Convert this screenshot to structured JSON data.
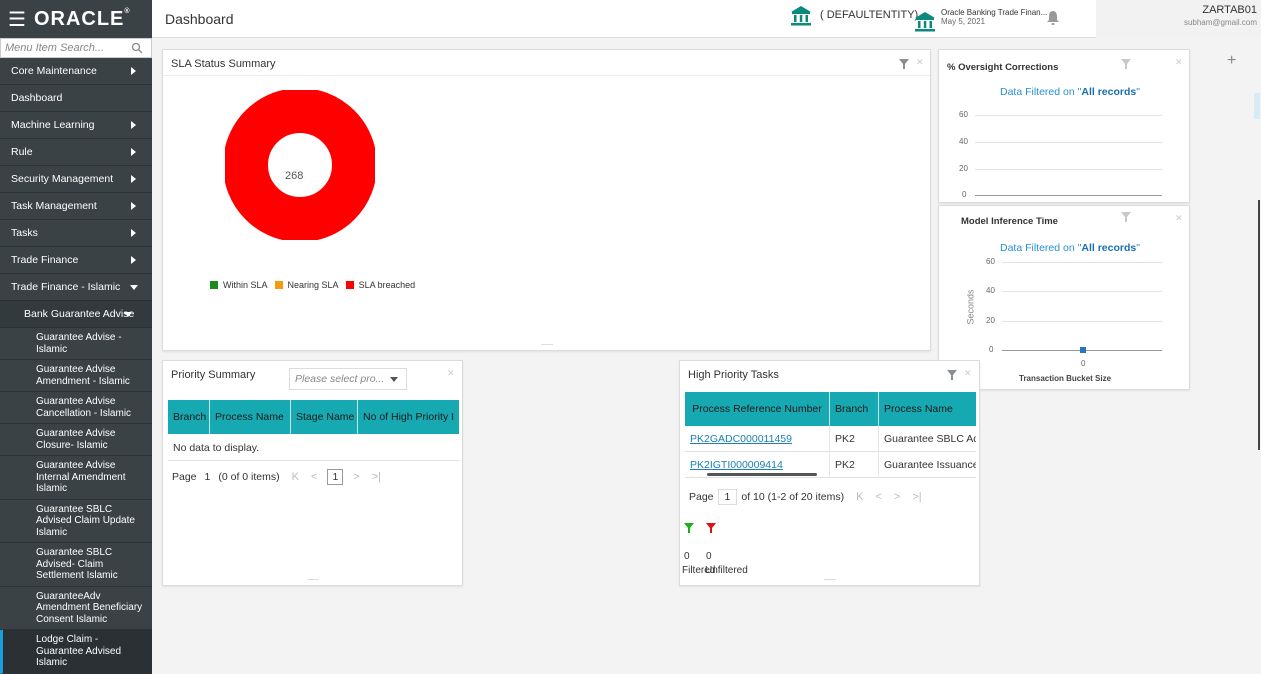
{
  "header": {
    "logo": "ORACLE",
    "page_title": "Dashboard",
    "entity": "( DEFAULTENTITY)",
    "app_name": "Oracle Banking Trade Finan...",
    "app_date": "May 5, 2021",
    "user_name": "ZARTAB01",
    "user_email": "subham@gmail.com"
  },
  "sidebar": {
    "search_placeholder": "Menu Item Search...",
    "items": [
      {
        "label": "Core Maintenance"
      },
      {
        "label": "Dashboard"
      },
      {
        "label": "Machine Learning"
      },
      {
        "label": "Rule"
      },
      {
        "label": "Security Management"
      },
      {
        "label": "Task Management"
      },
      {
        "label": "Tasks"
      },
      {
        "label": "Trade Finance"
      },
      {
        "label": "Trade Finance - Islamic"
      }
    ],
    "sub_group": "Bank Guarantee Advise",
    "leaves": [
      "Guarantee Advise - Islamic",
      "Guarantee Advise Amendment - Islamic",
      "Guarantee Advise Cancellation - Islamic",
      "Guarantee Advise Closure- Islamic",
      "Guarantee Advise Internal Amendment Islamic",
      "Guarantee SBLC Advised Claim Update Islamic",
      "Guarantee SBLC Advised- Claim Settlement Islamic",
      "GuaranteeAdv Amendment Beneficiary Consent Islamic",
      "Lodge Claim - Guarantee Advised Islamic"
    ]
  },
  "sla": {
    "title": "SLA Status Summary",
    "center_value": "268",
    "legend": [
      "Within SLA",
      "Nearing SLA",
      "SLA breached"
    ],
    "colors": {
      "within": "#1a8a1a",
      "nearing": "#f39c12",
      "breached": "#ff0000"
    }
  },
  "oversight": {
    "title": "% Oversight Corrections",
    "filter_prefix": "Data Filtered on \"",
    "filter_value": "All records",
    "filter_suffix": "\"",
    "y_ticks": [
      "60",
      "40",
      "20",
      "0"
    ]
  },
  "model": {
    "title": "Model Inference Time",
    "filter_prefix": "Data Filtered on \"",
    "filter_value": "All records",
    "filter_suffix": "\"",
    "y_ticks": [
      "60",
      "40",
      "20",
      "0"
    ],
    "y_label": "Seconds",
    "x_tick": "0",
    "x_label": "Transaction Bucket Size"
  },
  "priority": {
    "title": "Priority Summary",
    "select_placeholder": "Please select pro...",
    "columns": [
      "Branch",
      "Process Name",
      "Stage Name",
      "No of High Priority I"
    ],
    "empty": "No data to display.",
    "page_label": "Page",
    "page_value": "1",
    "page_info": "(0 of 0 items)",
    "current_page": "1"
  },
  "high_priority": {
    "title": "High Priority Tasks",
    "columns": [
      "Process Reference Number",
      "Branch",
      "Process Name"
    ],
    "rows": [
      {
        "ref": "PK2GADC000011459",
        "branch": "PK2",
        "process": "Guarantee SBLC Ad"
      },
      {
        "ref": "PK2IGTI000009414",
        "branch": "PK2",
        "process": "Guarantee Issuance"
      }
    ],
    "page_label": "Page",
    "page_value": "1",
    "page_info": "of 10  (1-2 of 20 items)",
    "filtered_count": "0",
    "unfiltered_count": "0",
    "filtered_label": "Filtered",
    "unfiltered_label": "Unfiltered"
  }
}
